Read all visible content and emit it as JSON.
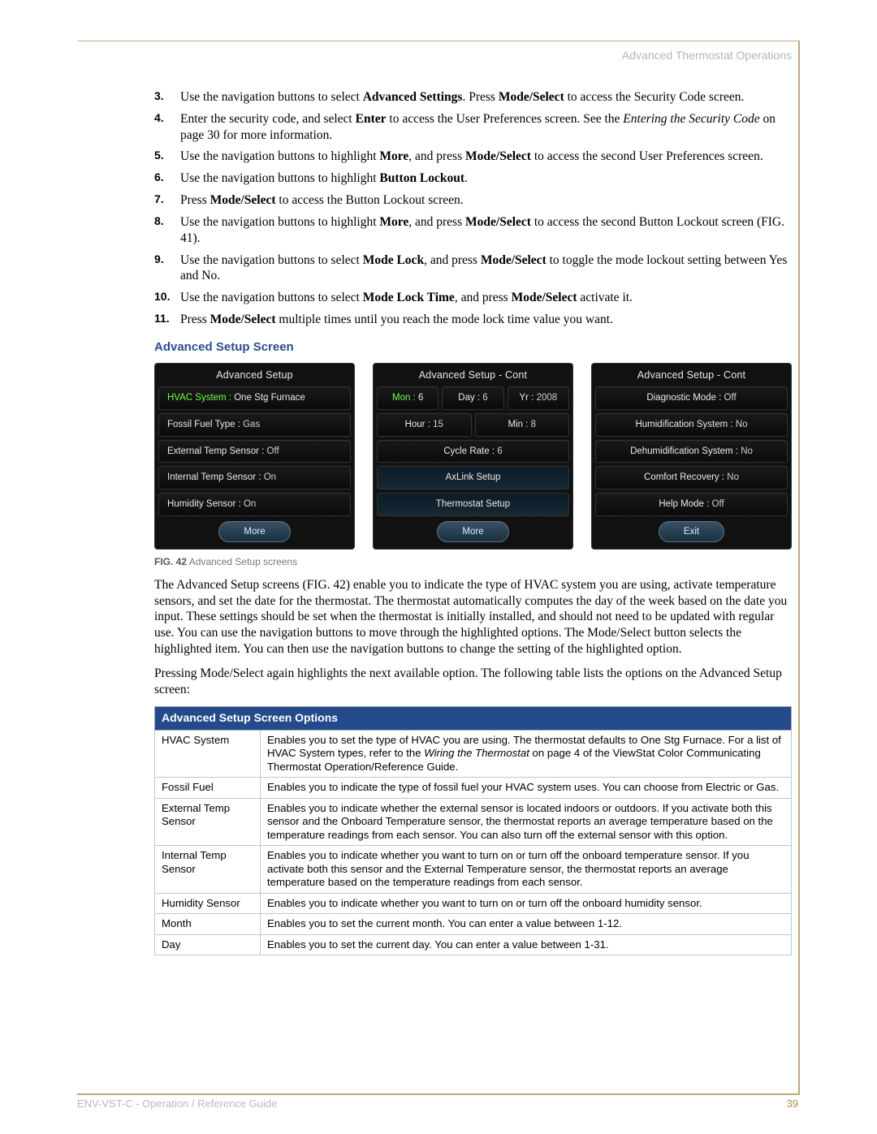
{
  "header": {
    "section": "Advanced Thermostat Operations"
  },
  "steps": [
    {
      "n": "3.",
      "parts": [
        "Use the navigation buttons to select ",
        {
          "b": "Advanced Settings"
        },
        ". Press ",
        {
          "b": "Mode/Select"
        },
        " to access the Security Code screen."
      ]
    },
    {
      "n": "4.",
      "parts": [
        "Enter the security code, and select ",
        {
          "b": "Enter"
        },
        " to access the User Preferences screen. See the ",
        {
          "i": "Entering the Security Code"
        },
        " on page 30 for more information."
      ]
    },
    {
      "n": "5.",
      "parts": [
        "Use the navigation buttons to highlight ",
        {
          "b": "More"
        },
        ", and press ",
        {
          "b": "Mode/Select"
        },
        " to access the second User Preferences screen."
      ]
    },
    {
      "n": "6.",
      "parts": [
        "Use the navigation buttons to highlight ",
        {
          "b": "Button Lockout"
        },
        "."
      ]
    },
    {
      "n": "7.",
      "parts": [
        "Press ",
        {
          "b": "Mode/Select"
        },
        " to access the Button Lockout screen."
      ]
    },
    {
      "n": "8.",
      "parts": [
        "Use the navigation buttons to highlight ",
        {
          "b": "More"
        },
        ", and press ",
        {
          "b": "Mode/Select"
        },
        " to access the second Button Lockout screen (FIG. 41)."
      ]
    },
    {
      "n": "9.",
      "parts": [
        "Use the navigation buttons to select ",
        {
          "b": "Mode Lock"
        },
        ", and press ",
        {
          "b": "Mode/Select"
        },
        " to toggle the mode lockout setting between Yes and No."
      ]
    },
    {
      "n": "10.",
      "parts": [
        "Use the navigation buttons to select ",
        {
          "b": "Mode Lock Time"
        },
        ", and press ",
        {
          "b": "Mode/Select"
        },
        " activate it."
      ]
    },
    {
      "n": "11.",
      "parts": [
        "Press ",
        {
          "b": "Mode/Select"
        },
        " multiple times until you reach the mode lock time value you want."
      ]
    }
  ],
  "section_heading": "Advanced Setup Screen",
  "screens": [
    {
      "title": "Advanced Setup",
      "rows": [
        {
          "type": "kv",
          "selected": true,
          "label": "HVAC System :",
          "val": "One Stg Furnace"
        },
        {
          "type": "kv",
          "label": "Fossil Fuel Type :",
          "val": "Gas"
        },
        {
          "type": "kv",
          "label": "External Temp Sensor :",
          "val": "Off"
        },
        {
          "type": "kv",
          "label": "Internal Temp Sensor :",
          "val": "On"
        },
        {
          "type": "kv",
          "label": "Humidity Sensor :",
          "val": "On"
        }
      ],
      "button": "More"
    },
    {
      "title": "Advanced Setup - Cont",
      "rows": [
        {
          "type": "inline3",
          "selected": true,
          "cells": [
            {
              "label": "Mon :",
              "val": "6"
            },
            {
              "label": "Day :",
              "val": "6"
            },
            {
              "label": "Yr :",
              "val": "2008"
            }
          ]
        },
        {
          "type": "inline2",
          "cells": [
            {
              "label": "Hour :",
              "val": "15"
            },
            {
              "label": "Min :",
              "val": "8"
            }
          ]
        },
        {
          "type": "kvcenter",
          "label": "Cycle Rate :",
          "val": "6"
        },
        {
          "type": "inset",
          "label": "AxLink Setup"
        },
        {
          "type": "inset",
          "label": "Thermostat Setup"
        }
      ],
      "button": "More"
    },
    {
      "title": "Advanced Setup - Cont",
      "rows": [
        {
          "type": "kvcenter",
          "label": "Diagnostic Mode :",
          "val": "Off"
        },
        {
          "type": "kvcenter",
          "label": "Humidification System :",
          "val": "No"
        },
        {
          "type": "kvcenter",
          "label": "Dehumidification System :",
          "val": "No"
        },
        {
          "type": "kvcenter",
          "label": "Comfort Recovery :",
          "val": "No"
        },
        {
          "type": "kvcenter",
          "label": "Help Mode :",
          "val": "Off"
        }
      ],
      "button": "Exit"
    }
  ],
  "figure": {
    "num": "FIG. 42",
    "caption": "Advanced Setup screens"
  },
  "body_paras": [
    "The Advanced Setup screens (FIG. 42) enable you to indicate the type of HVAC system you are using, activate temperature sensors, and set the date for the thermostat. The thermostat automatically computes the day of the week based on the date you input. These settings should be set when the thermostat is initially installed, and should not need to be updated with regular use. You can use the navigation buttons to move through the highlighted options. The Mode/Select button selects the highlighted item. You can then use the navigation buttons to change the setting of the highlighted option.",
    "Pressing Mode/Select again highlights the next available option. The following table lists the options on the Advanced Setup screen:"
  ],
  "table": {
    "header": "Advanced Setup Screen Options",
    "rows": [
      {
        "name": "HVAC System",
        "desc_parts": [
          "Enables you to set the type of HVAC you are using. The thermostat defaults to One Stg Furnace. For a list of HVAC System types, refer to the ",
          {
            "i": "Wiring the Thermostat"
          },
          " on page 4 of the ViewStat Color Communicating Thermostat Operation/Reference Guide."
        ]
      },
      {
        "name": "Fossil Fuel",
        "desc_parts": [
          "Enables you to indicate the type of fossil fuel your HVAC system uses. You can choose from Electric or Gas."
        ]
      },
      {
        "name": "External Temp Sensor",
        "desc_parts": [
          "Enables you to indicate whether the external sensor is located indoors or outdoors. If you activate both this sensor and the Onboard Temperature sensor, the thermostat reports an average temperature based on the temperature readings from each sensor. You can also turn off the external sensor with this option."
        ]
      },
      {
        "name": "Internal Temp Sensor",
        "desc_parts": [
          "Enables you to indicate whether you want to turn on or turn off the onboard temperature sensor. If you activate both this sensor and the External Temperature sensor, the thermostat reports an average temperature based on the temperature readings from each sensor."
        ]
      },
      {
        "name": "Humidity Sensor",
        "desc_parts": [
          "Enables you to indicate whether you want to turn on or turn off the onboard humidity sensor."
        ]
      },
      {
        "name": "Month",
        "desc_parts": [
          "Enables you to set the current month. You can enter a value between 1-12."
        ]
      },
      {
        "name": "Day",
        "desc_parts": [
          "Enables you to set the current day. You can enter a value between 1-31."
        ]
      }
    ]
  },
  "footer": {
    "doc": "ENV-VST-C - Operation / Reference Guide",
    "page": "39"
  }
}
